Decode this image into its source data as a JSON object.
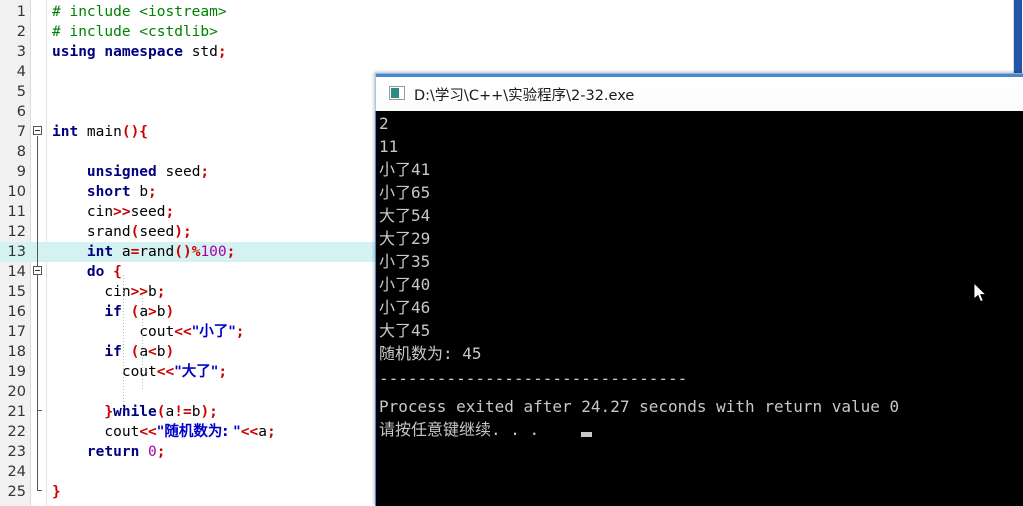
{
  "editor": {
    "name": "code-editor",
    "highlighted_line": 13,
    "lines": [
      {
        "n": "1",
        "tokens": [
          {
            "t": "# include <iostream>",
            "c": "pre"
          }
        ]
      },
      {
        "n": "2",
        "tokens": [
          {
            "t": "# include <cstdlib>",
            "c": "pre"
          }
        ]
      },
      {
        "n": "3",
        "tokens": [
          {
            "t": "using namespace ",
            "c": "k"
          },
          {
            "t": "std",
            "c": "id"
          },
          {
            "t": ";",
            "c": "op"
          }
        ]
      },
      {
        "n": "4",
        "tokens": []
      },
      {
        "n": "5",
        "tokens": []
      },
      {
        "n": "6",
        "tokens": []
      },
      {
        "n": "7",
        "tokens": [
          {
            "t": "int ",
            "c": "k"
          },
          {
            "t": "main",
            "c": "id"
          },
          {
            "t": "(){",
            "c": "op"
          }
        ]
      },
      {
        "n": "8",
        "tokens": []
      },
      {
        "n": "9",
        "tokens": [
          {
            "t": "    unsigned ",
            "c": "k"
          },
          {
            "t": "seed",
            "c": "id"
          },
          {
            "t": ";",
            "c": "op"
          }
        ]
      },
      {
        "n": "10",
        "tokens": [
          {
            "t": "    short ",
            "c": "k"
          },
          {
            "t": "b",
            "c": "id"
          },
          {
            "t": ";",
            "c": "op"
          }
        ]
      },
      {
        "n": "11",
        "tokens": [
          {
            "t": "    cin",
            "c": "id"
          },
          {
            "t": ">>",
            "c": "op"
          },
          {
            "t": "seed",
            "c": "id"
          },
          {
            "t": ";",
            "c": "op"
          }
        ]
      },
      {
        "n": "12",
        "tokens": [
          {
            "t": "    srand",
            "c": "id"
          },
          {
            "t": "(",
            "c": "op"
          },
          {
            "t": "seed",
            "c": "id"
          },
          {
            "t": ");",
            "c": "op"
          }
        ]
      },
      {
        "n": "13",
        "tokens": [
          {
            "t": "    int ",
            "c": "k"
          },
          {
            "t": "a",
            "c": "id"
          },
          {
            "t": "=",
            "c": "op"
          },
          {
            "t": "rand",
            "c": "id"
          },
          {
            "t": "()%",
            "c": "op"
          },
          {
            "t": "100",
            "c": "num"
          },
          {
            "t": ";",
            "c": "op"
          }
        ]
      },
      {
        "n": "14",
        "tokens": [
          {
            "t": "    do ",
            "c": "k"
          },
          {
            "t": "{",
            "c": "op"
          }
        ]
      },
      {
        "n": "15",
        "tokens": [
          {
            "t": "      cin",
            "c": "id"
          },
          {
            "t": ">>",
            "c": "op"
          },
          {
            "t": "b",
            "c": "id"
          },
          {
            "t": ";",
            "c": "op"
          }
        ]
      },
      {
        "n": "16",
        "tokens": [
          {
            "t": "      if ",
            "c": "k"
          },
          {
            "t": "(",
            "c": "op"
          },
          {
            "t": "a",
            "c": "id"
          },
          {
            "t": ">",
            "c": "op"
          },
          {
            "t": "b",
            "c": "id"
          },
          {
            "t": ")",
            "c": "op"
          }
        ]
      },
      {
        "n": "17",
        "tokens": [
          {
            "t": "          cout",
            "c": "id"
          },
          {
            "t": "<<",
            "c": "op"
          },
          {
            "t": "\"小了\"",
            "c": "str"
          },
          {
            "t": ";",
            "c": "op"
          }
        ]
      },
      {
        "n": "18",
        "tokens": [
          {
            "t": "      if ",
            "c": "k"
          },
          {
            "t": "(",
            "c": "op"
          },
          {
            "t": "a",
            "c": "id"
          },
          {
            "t": "<",
            "c": "op"
          },
          {
            "t": "b",
            "c": "id"
          },
          {
            "t": ")",
            "c": "op"
          }
        ]
      },
      {
        "n": "19",
        "tokens": [
          {
            "t": "        cout",
            "c": "id"
          },
          {
            "t": "<<",
            "c": "op"
          },
          {
            "t": "\"大了\"",
            "c": "str"
          },
          {
            "t": ";",
            "c": "op"
          }
        ]
      },
      {
        "n": "20",
        "tokens": []
      },
      {
        "n": "21",
        "tokens": [
          {
            "t": "      }",
            "c": "op"
          },
          {
            "t": "while",
            "c": "k"
          },
          {
            "t": "(",
            "c": "op"
          },
          {
            "t": "a",
            "c": "id"
          },
          {
            "t": "!=",
            "c": "op"
          },
          {
            "t": "b",
            "c": "id"
          },
          {
            "t": ");",
            "c": "op"
          }
        ]
      },
      {
        "n": "22",
        "tokens": [
          {
            "t": "      cout",
            "c": "id"
          },
          {
            "t": "<<",
            "c": "op"
          },
          {
            "t": "\"随机数为: \"",
            "c": "str"
          },
          {
            "t": "<<",
            "c": "op"
          },
          {
            "t": "a",
            "c": "id"
          },
          {
            "t": ";",
            "c": "op"
          }
        ]
      },
      {
        "n": "23",
        "tokens": [
          {
            "t": "    return ",
            "c": "k"
          },
          {
            "t": "0",
            "c": "num"
          },
          {
            "t": ";",
            "c": "op"
          }
        ]
      },
      {
        "n": "24",
        "tokens": []
      },
      {
        "n": "25",
        "tokens": [
          {
            "t": "}",
            "c": "op"
          }
        ]
      }
    ]
  },
  "console": {
    "title": "D:\\学习\\C++\\实验程序\\2-32.exe",
    "icon": "console-icon",
    "output_lines": [
      "2",
      "11",
      "小了41",
      "小了65",
      "大了54",
      "大了29",
      "小了35",
      "小了40",
      "小了46",
      "大了45",
      "随机数为: 45"
    ],
    "separator": "--------------------------------",
    "exit_message": "Process exited after 24.27 seconds with return value 0",
    "prompt": "请按任意键继续. . . "
  },
  "colors": {
    "keyword": "#000080",
    "operator": "#cc0000",
    "string": "#0000cc",
    "number": "#aa00aa",
    "preprocessor": "#008000",
    "highlight_line": "#d4f2f2",
    "console_bg": "#000000",
    "console_fg": "#c8c8c8",
    "title_accent": "#4a86c8"
  }
}
